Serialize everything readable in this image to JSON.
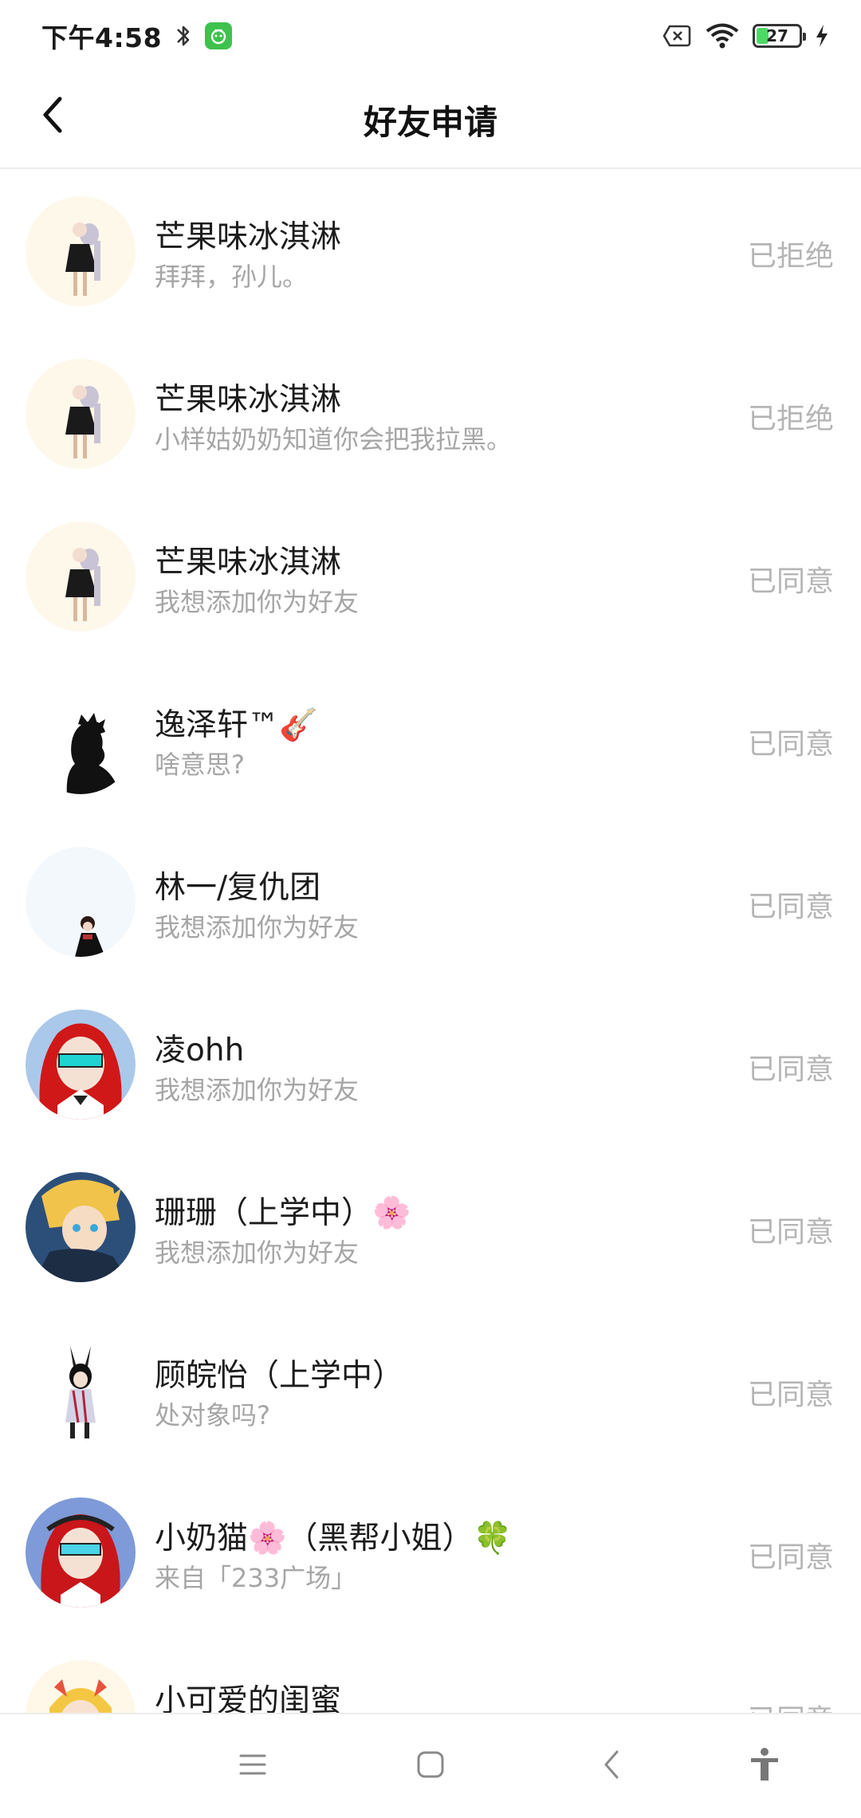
{
  "status_bar": {
    "time": "下午4:58",
    "battery_level": "27",
    "icons": [
      "bluetooth-icon",
      "app-notification-icon",
      "sim-off-icon",
      "wifi-icon",
      "battery-icon",
      "charging-icon"
    ]
  },
  "header": {
    "title": "好友申请",
    "back_icon": "back-arrow-icon"
  },
  "requests": [
    {
      "name": "芒果味冰淇淋",
      "message": "拜拜，孙儿。",
      "status": "已拒绝",
      "avatar": "anime-girl-light"
    },
    {
      "name": "芒果味冰淇淋",
      "message": "小样姑奶奶知道你会把我拉黑。",
      "status": "已拒绝",
      "avatar": "anime-girl-light"
    },
    {
      "name": "芒果味冰淇淋",
      "message": "我想添加你为好友",
      "status": "已同意",
      "avatar": "anime-girl-light"
    },
    {
      "name": "逸泽轩™🎸",
      "message": "啥意思?",
      "status": "已同意",
      "avatar": "silhouette"
    },
    {
      "name": "林一/复仇团",
      "message": "我想添加你为好友",
      "status": "已同意",
      "avatar": "small-figure"
    },
    {
      "name": "凌ohh",
      "message": "我想添加你为好友",
      "status": "已同意",
      "avatar": "red-hair"
    },
    {
      "name": "珊珊（上学中）🌸",
      "message": "我想添加你为好友",
      "status": "已同意",
      "avatar": "blonde-anime"
    },
    {
      "name": "顾皖怡（上学中）",
      "message": "处对象吗?",
      "status": "已同意",
      "avatar": "bunny-girl"
    },
    {
      "name": "小奶猫🌸（黑帮小姐）🍀",
      "message": "来自「233广场」",
      "status": "已同意",
      "avatar": "red-hair-blue"
    },
    {
      "name": "小可爱的闺蜜",
      "message": "",
      "status": "已同意",
      "avatar": "yellow-hair"
    }
  ],
  "nav_bar": {
    "buttons": [
      "menu-icon",
      "home-icon",
      "back-icon",
      "accessibility-icon"
    ]
  },
  "colors": {
    "status_text": "#b5b5b5",
    "message_text": "#a6a6a6",
    "name_text": "#1c1c1c"
  }
}
